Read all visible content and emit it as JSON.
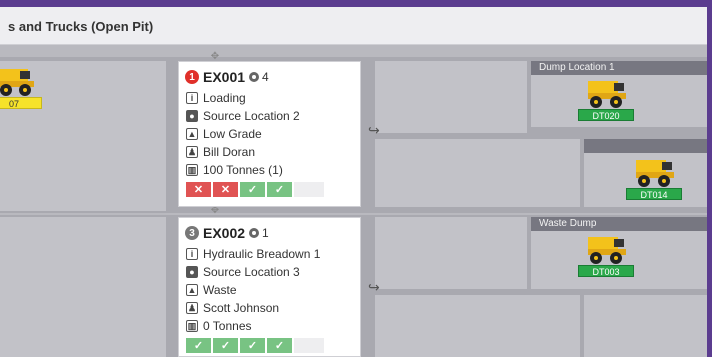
{
  "title": "s and Trucks (Open Pit)",
  "cards": [
    {
      "id": "EX001",
      "badge": "1",
      "badge_color": "#e0302a",
      "gear_count": "4",
      "status_color": "#4fb14f",
      "warning_icon": "warning-triangle-icon",
      "activity": "Loading",
      "location": "Source Location 2",
      "material": "Low Grade",
      "operator": "Bill Doran",
      "tonnes": "100 Tonnes (1)",
      "checks": [
        "x",
        "x",
        "ok",
        "ok"
      ]
    },
    {
      "id": "EX002",
      "badge": "3",
      "badge_color": "#777777",
      "gear_count": "1",
      "status_color": "#e22424",
      "activity": "Hydraulic Breadown 1",
      "location": "Source Location 3",
      "material": "Waste",
      "operator": "Scott Johnson",
      "tonnes": "0 Tonnes",
      "checks": [
        "ok",
        "ok",
        "ok",
        "ok"
      ]
    }
  ],
  "destinations": [
    {
      "label": "Dump Location 1"
    },
    {
      "label": "Waste Dump"
    }
  ],
  "trucks": [
    {
      "tag": "07",
      "tag_color": "yellow"
    },
    {
      "tag": "DT020",
      "tag_color": "green"
    },
    {
      "tag": "DT014",
      "tag_color": "green"
    },
    {
      "tag": "DT003",
      "tag_color": "green"
    }
  ],
  "colors": {
    "background": "#5b3c8f",
    "lane": "#a9a9b0",
    "panel": "#c2c2c8",
    "ok": "#78c383",
    "fail": "#e05353",
    "tag": "#2aa84a"
  }
}
